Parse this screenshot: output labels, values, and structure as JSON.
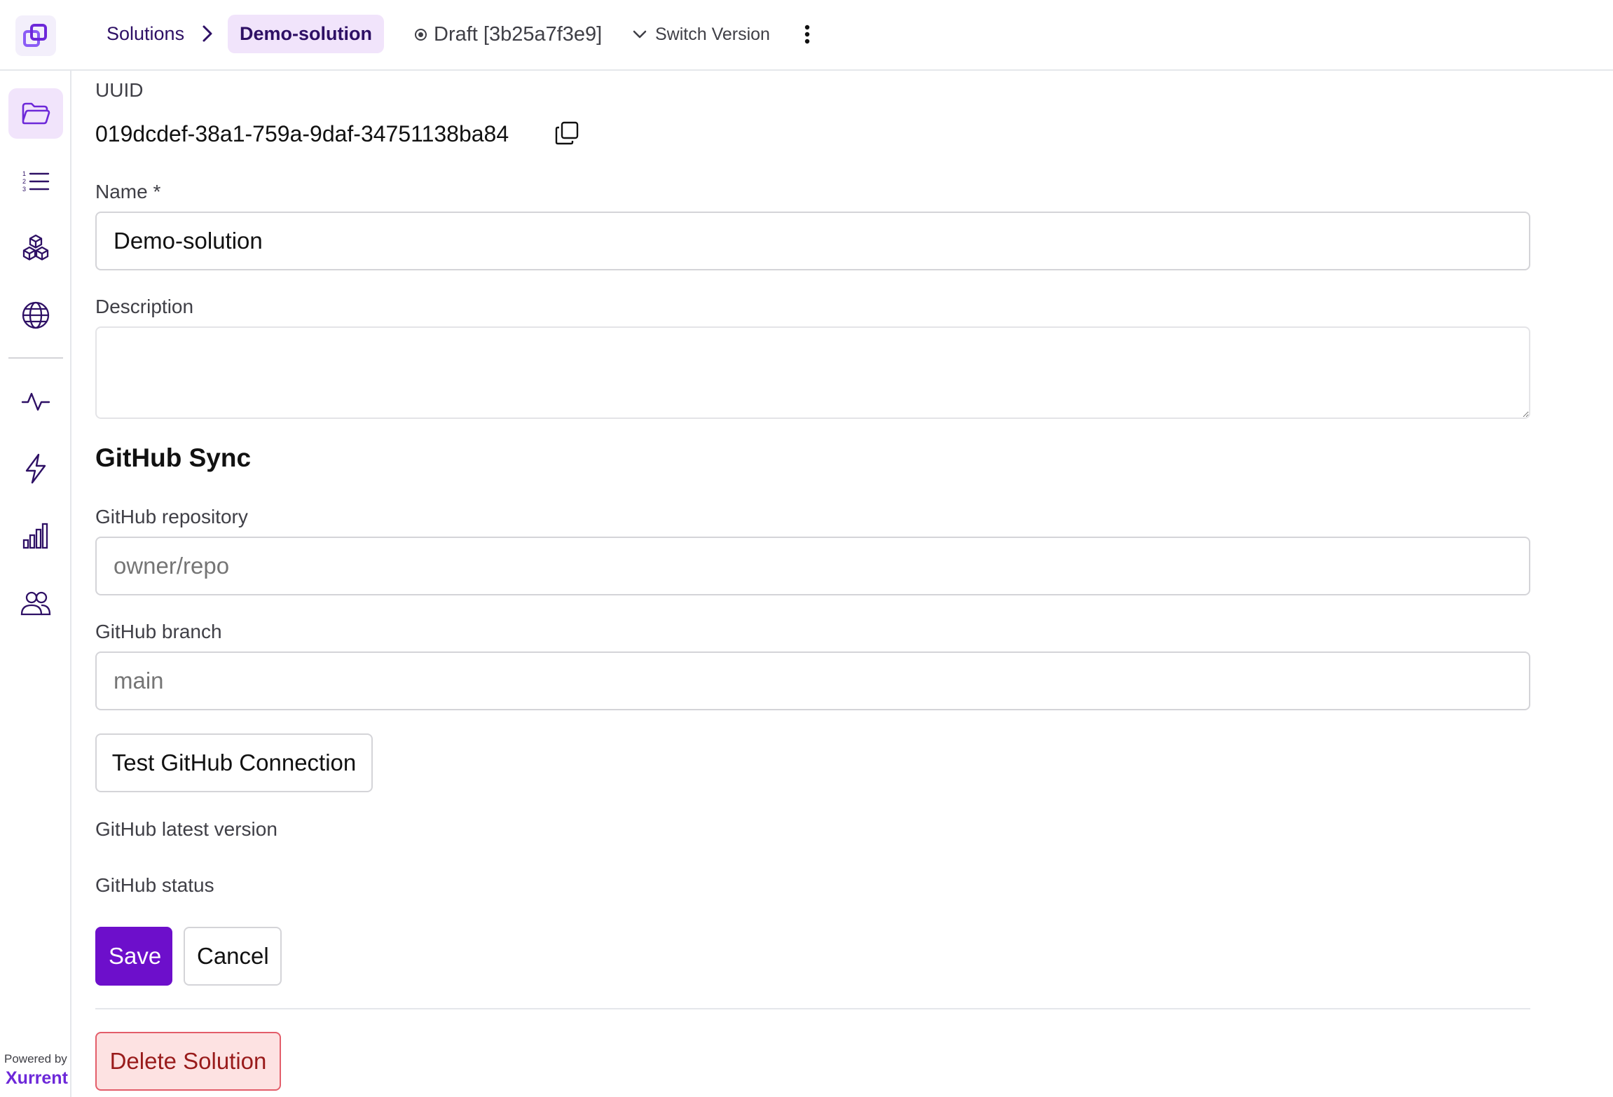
{
  "header": {
    "breadcrumb_root": "Solutions",
    "breadcrumb_current": "Demo-solution",
    "version_status": "Draft [3b25a7f3e9]",
    "switch_version": "Switch Version"
  },
  "sidebar": {
    "items": [
      {
        "icon": "folder-icon",
        "active": true
      },
      {
        "icon": "numbered-list-icon",
        "active": false
      },
      {
        "icon": "cubes-icon",
        "active": false
      },
      {
        "icon": "globe-icon",
        "active": false
      },
      {
        "icon": "activity-icon",
        "active": false
      },
      {
        "icon": "lightning-icon",
        "active": false
      },
      {
        "icon": "bar-chart-icon",
        "active": false
      },
      {
        "icon": "users-icon",
        "active": false
      }
    ],
    "powered_by": "Powered by",
    "brand": "Xurrent"
  },
  "form": {
    "uuid_label": "UUID",
    "uuid_value": "019dcdef-38a1-759a-9daf-34751138ba84",
    "name_label": "Name *",
    "name_value": "Demo-solution",
    "description_label": "Description",
    "description_value": "",
    "github_section_title": "GitHub Sync",
    "repo_label": "GitHub repository",
    "repo_placeholder": "owner/repo",
    "branch_label": "GitHub branch",
    "branch_placeholder": "main",
    "test_button": "Test GitHub Connection",
    "latest_version_label": "GitHub latest version",
    "status_label": "GitHub status",
    "save_button": "Save",
    "cancel_button": "Cancel",
    "delete_button": "Delete Solution"
  },
  "colors": {
    "accent": "#6d0fcb",
    "accent_light": "#f1e4fb",
    "danger_bg": "#fde2e2",
    "danger_text": "#991b1b"
  }
}
